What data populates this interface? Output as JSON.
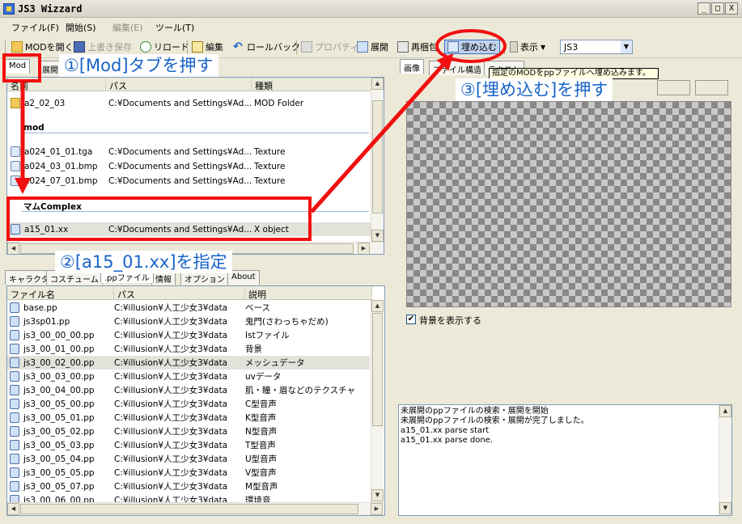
{
  "window": {
    "title": "JS3 Wizzard",
    "min": "_",
    "max": "□",
    "close": "X"
  },
  "menu": [
    {
      "label": "ファイル(F)",
      "enabled": true
    },
    {
      "label": "開始(S)",
      "enabled": true
    },
    {
      "label": "編集(E)",
      "enabled": false
    },
    {
      "label": "ツール(T)",
      "enabled": true
    }
  ],
  "toolbar": {
    "open_mod": "MODを開く",
    "overwrite_save": "上書き保存",
    "reload": "リロード",
    "edit": "編集",
    "rollback": "ロールバック",
    "properties": "プロパティ",
    "expand": "展開",
    "repack": "再梱包",
    "embed": "埋め込む",
    "view": "表示",
    "profile": "JS3"
  },
  "top_panel": {
    "tabs": [
      "Mod",
      "展開"
    ],
    "columns": [
      "名前",
      "パス",
      "種類"
    ],
    "rows": [
      {
        "name": "a2_02_03",
        "path": "C:¥Documents and Settings¥Ad...",
        "type": "MOD Folder",
        "icon": "folder"
      },
      {
        "group": "mod"
      },
      {
        "name": "a024_01_01.tga",
        "path": "C:¥Documents and Settings¥Ad...",
        "type": "Texture",
        "icon": "texture"
      },
      {
        "name": "a024_03_01.bmp",
        "path": "C:¥Documents and Settings¥Ad...",
        "type": "Texture",
        "icon": "texture"
      },
      {
        "name": "a024_07_01.bmp",
        "path": "C:¥Documents and Settings¥Ad...",
        "type": "Texture",
        "icon": "texture"
      },
      {
        "group": "マムComplex"
      },
      {
        "name": "a15_01.xx",
        "path": "C:¥Documents and Settings¥Ad...",
        "type": "X object",
        "icon": "xfile",
        "selected": true
      }
    ]
  },
  "bottom_panel": {
    "tabs": [
      "キャラクタ",
      "コスチューム",
      ".ppファイル",
      "情報",
      "オプション",
      "About"
    ],
    "columns": [
      "ファイル名",
      "パス",
      "説明"
    ],
    "rows": [
      {
        "file": "base.pp",
        "path": "C:¥illusion¥人工少女3¥data",
        "desc": "ベース"
      },
      {
        "file": "js3sp01.pp",
        "path": "C:¥illusion¥人工少女3¥data",
        "desc": "鬼門(さわっちゃだめ)"
      },
      {
        "file": "js3_00_00_00.pp",
        "path": "C:¥illusion¥人工少女3¥data",
        "desc": "Istファイル"
      },
      {
        "file": "js3_00_01_00.pp",
        "path": "C:¥illusion¥人工少女3¥data",
        "desc": "背景"
      },
      {
        "file": "js3_00_02_00.pp",
        "path": "C:¥illusion¥人工少女3¥data",
        "desc": "メッシュデータ",
        "selected": true
      },
      {
        "file": "js3_00_03_00.pp",
        "path": "C:¥illusion¥人工少女3¥data",
        "desc": "uvデータ"
      },
      {
        "file": "js3_00_04_00.pp",
        "path": "C:¥illusion¥人工少女3¥data",
        "desc": "肌・瞳・眉などのテクスチャ"
      },
      {
        "file": "js3_00_05_00.pp",
        "path": "C:¥illusion¥人工少女3¥data",
        "desc": "C型音声"
      },
      {
        "file": "js3_00_05_01.pp",
        "path": "C:¥illusion¥人工少女3¥data",
        "desc": "K型音声"
      },
      {
        "file": "js3_00_05_02.pp",
        "path": "C:¥illusion¥人工少女3¥data",
        "desc": "N型音声"
      },
      {
        "file": "js3_00_05_03.pp",
        "path": "C:¥illusion¥人工少女3¥data",
        "desc": "T型音声"
      },
      {
        "file": "js3_00_05_04.pp",
        "path": "C:¥illusion¥人工少女3¥data",
        "desc": "U型音声"
      },
      {
        "file": "js3_00_05_05.pp",
        "path": "C:¥illusion¥人工少女3¥data",
        "desc": "V型音声"
      },
      {
        "file": "js3_00_05_07.pp",
        "path": "C:¥illusion¥人工少女3¥data",
        "desc": "M型音声"
      },
      {
        "file": "js3_00_06_00.pp",
        "path": "C:¥illusion¥人工少女3¥data",
        "desc": "環境音"
      }
    ]
  },
  "right_panel": {
    "tabs": [
      "画像",
      "ファイル構造",
      "テキスト"
    ],
    "tooltip": "指定のMODをppファイルへ埋め込みます。",
    "show_background_label": "背景を表示する",
    "show_background_checked": true,
    "log_lines": [
      "未展開のppファイルの検索・展開を開始",
      "未展開のppファイルの検索・展開が完了しました。",
      "a15_01.xx parse start",
      "a15_01.xx parse done."
    ]
  },
  "annotations": {
    "step1": "①[Mod]タブを押す",
    "step2": "②[a15_01.xx]を指定",
    "step3": "③[埋め込む]を押す",
    "color": "#f20f0f",
    "text_color": "#1763c8"
  }
}
